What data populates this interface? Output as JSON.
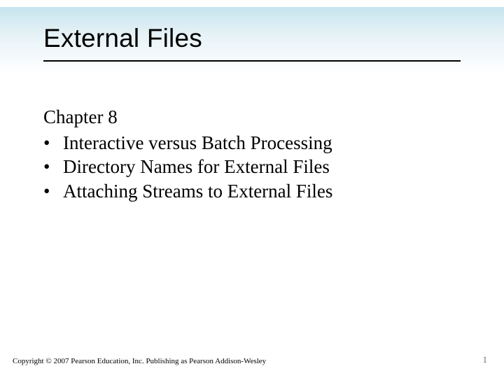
{
  "slide": {
    "title": "External Files",
    "chapter": "Chapter 8",
    "bullets": [
      "Interactive versus Batch Processing",
      "Directory Names for External Files",
      "Attaching Streams to External Files"
    ],
    "footer": "Copyright © 2007 Pearson Education, Inc. Publishing as Pearson Addison-Wesley",
    "page_number": "1"
  }
}
